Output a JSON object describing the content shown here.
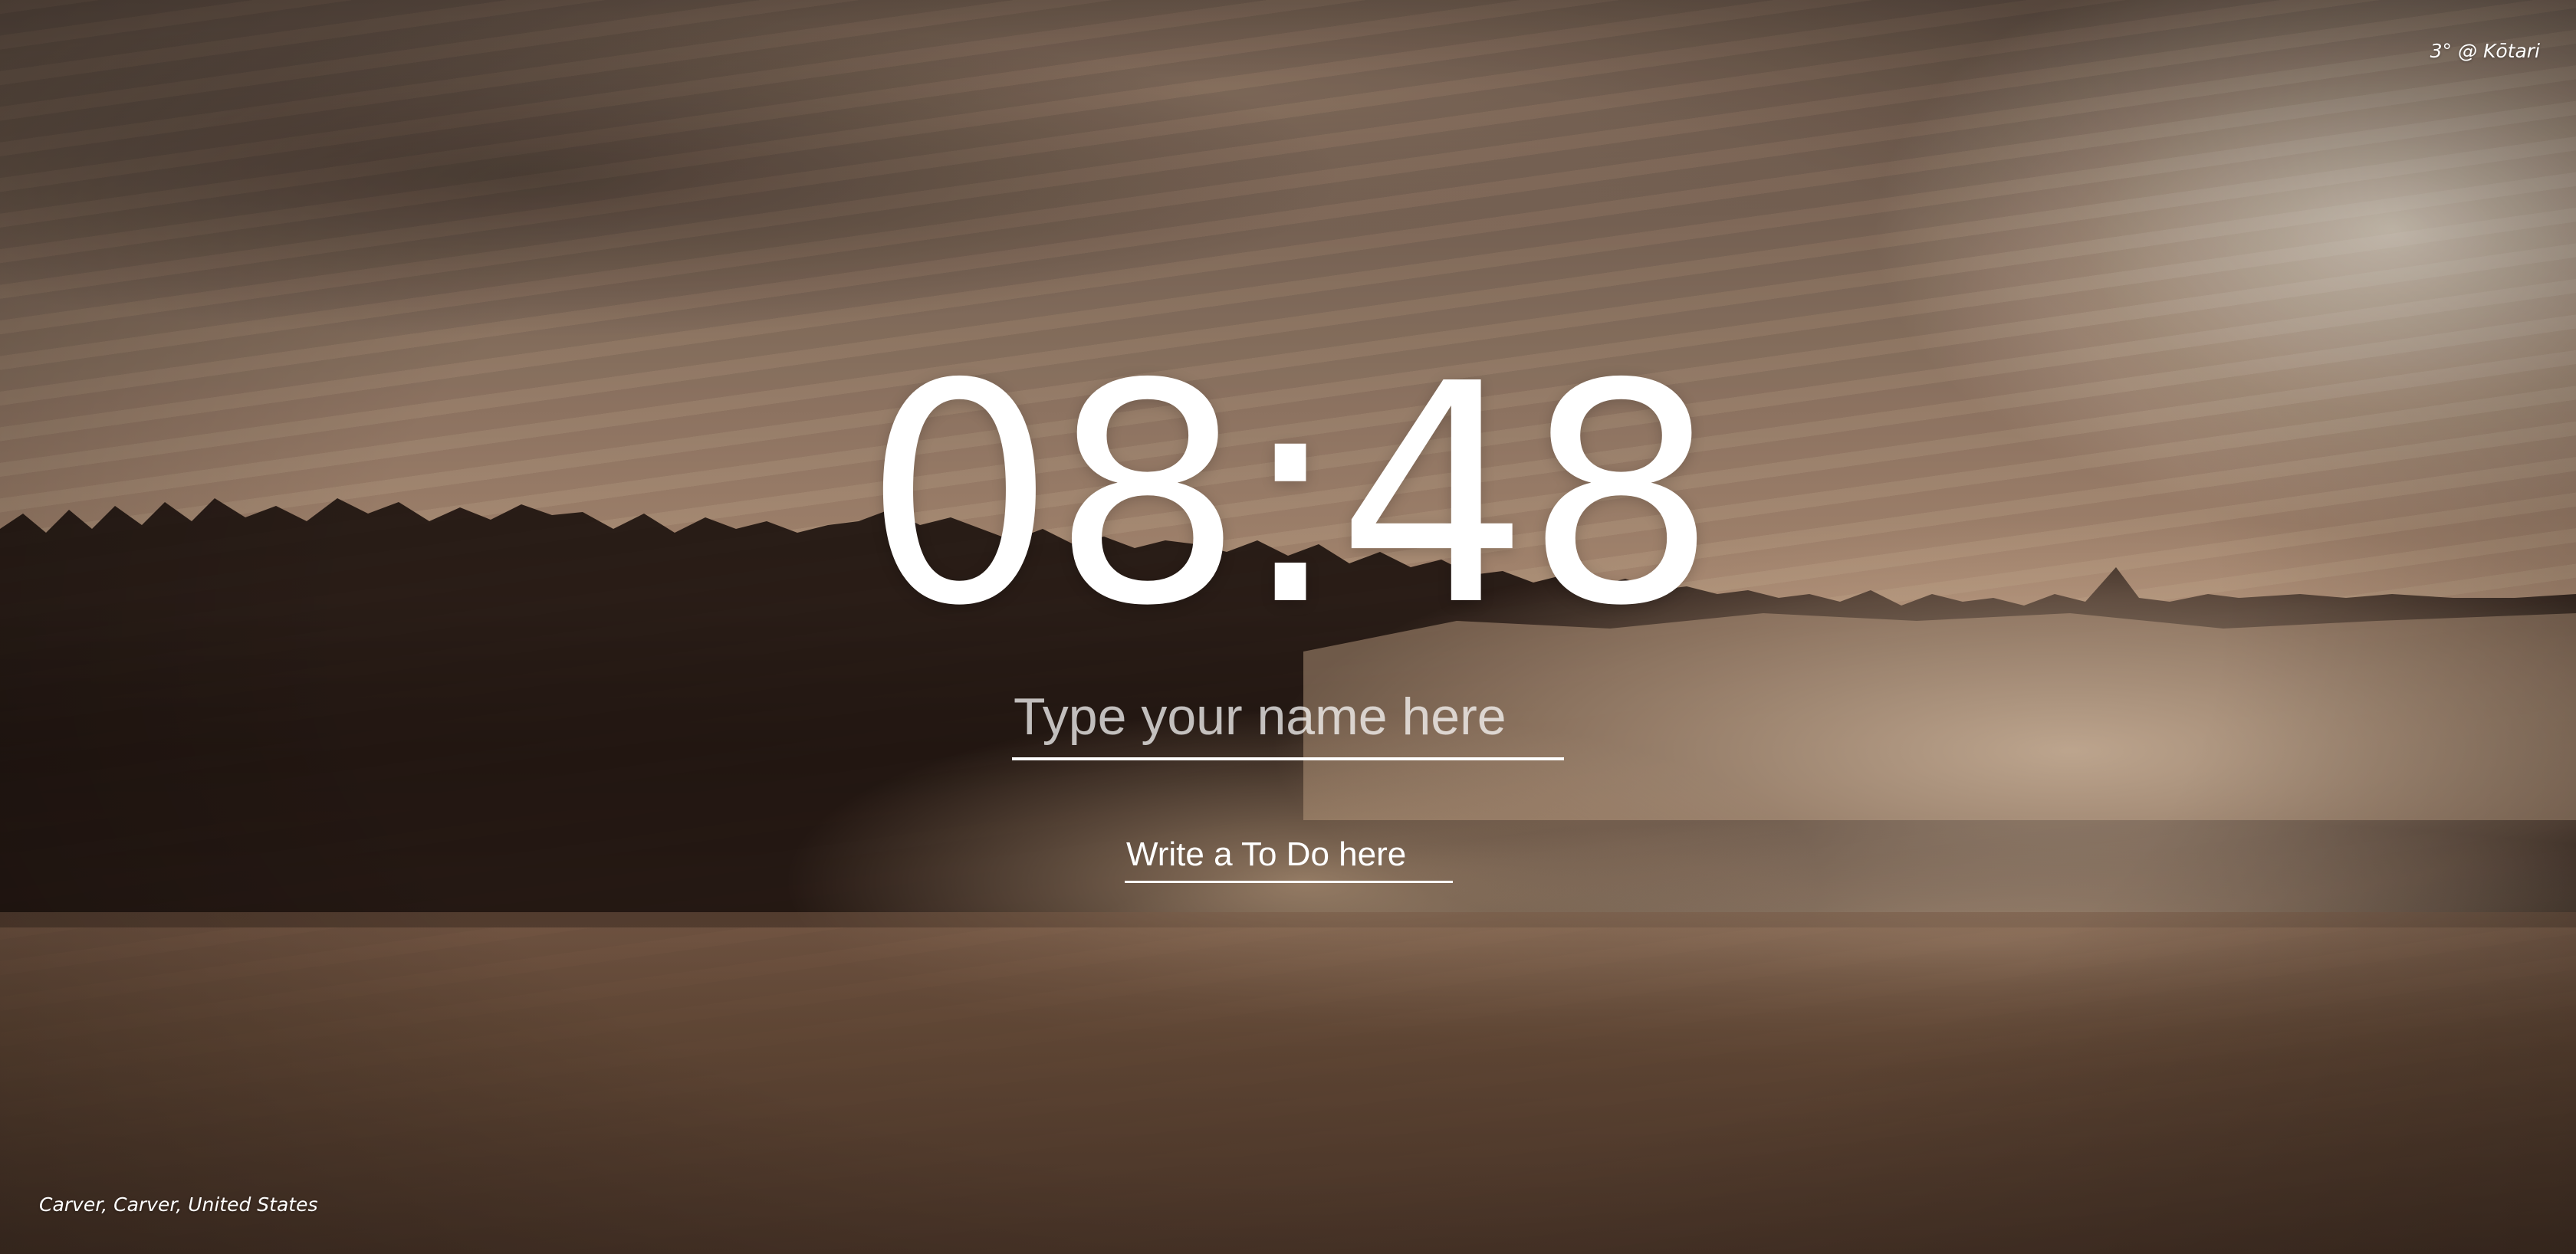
{
  "weather": {
    "text": "3° @ Kōtari"
  },
  "clock": {
    "time": "08:48"
  },
  "name_input": {
    "placeholder": "Type your name here",
    "value": ""
  },
  "todo_input": {
    "placeholder": "Write a To Do here",
    "value": ""
  },
  "location": {
    "text": "Carver, Carver, United States"
  },
  "background": {
    "description_icon": "misty-sunrise-photo"
  }
}
